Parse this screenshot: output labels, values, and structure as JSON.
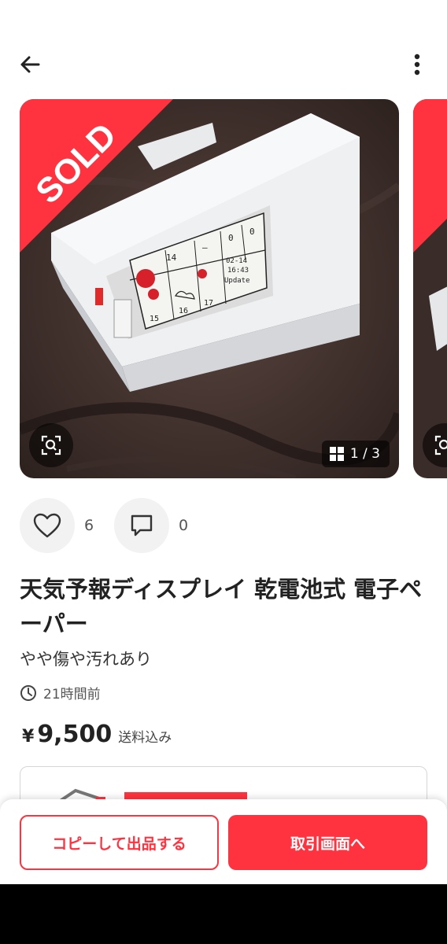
{
  "header": {
    "back_icon": "arrow-left-icon",
    "more_icon": "more-vertical-icon"
  },
  "gallery": {
    "sold_label": "SOLD",
    "counter": "1 / 3",
    "zoom_icon": "zoom-scan-icon",
    "grid_icon": "grid-icon",
    "device": {
      "cells_top": [
        "14",
        "—",
        "—",
        "0",
        "0"
      ],
      "cells_bottom": [
        "15",
        "16",
        "17"
      ],
      "date": "02-14",
      "time": "16:43",
      "update": "Update"
    }
  },
  "actions": {
    "like_count": "6",
    "comment_count": "0",
    "like_icon": "heart-icon",
    "comment_icon": "comment-icon"
  },
  "item": {
    "title": "天気予報ディスプレイ 乾電池式 電子ペーパー",
    "condition": "やや傷や汚れあり",
    "posted": "21時間前",
    "currency": "¥",
    "price": "9,500",
    "shipping": "送料込み"
  },
  "buttons": {
    "copy_label": "コピーして出品する",
    "transaction_label": "取引画面へ"
  },
  "colors": {
    "accent": "#ff333f",
    "text": "#222222"
  }
}
